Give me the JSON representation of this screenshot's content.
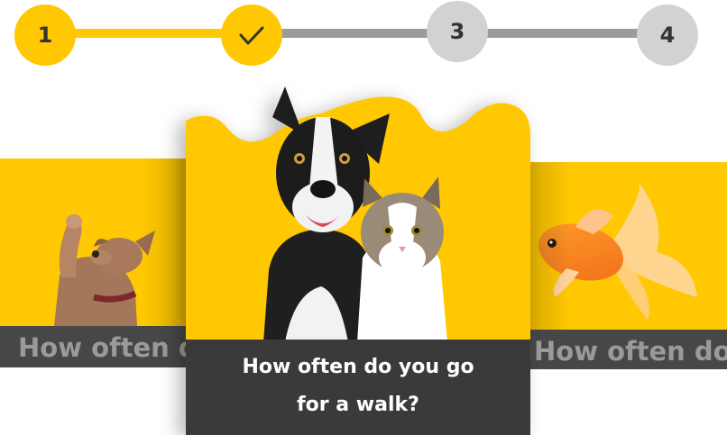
{
  "stepper": {
    "steps": [
      {
        "label": "1",
        "state": "active"
      },
      {
        "label": "",
        "state": "completed",
        "icon": "checkmark-icon"
      },
      {
        "label": "3",
        "state": "pending"
      },
      {
        "label": "4",
        "state": "pending"
      }
    ],
    "colors": {
      "active": "#ffc802",
      "pending": "#d2d2d2",
      "track_done": "#ffc802",
      "track_todo": "#9b9b9b"
    }
  },
  "cards": {
    "left": {
      "caption": "How often do",
      "image": "dog-waving-icon"
    },
    "main": {
      "caption_line1": "How often do you go",
      "caption_line2": "for a walk?",
      "image": "dog-and-cat-icon"
    },
    "right": {
      "caption": "How often do",
      "image": "goldfish-icon"
    }
  },
  "theme": {
    "accent": "#ffc802",
    "caption_dark": "#3a3a3a"
  }
}
